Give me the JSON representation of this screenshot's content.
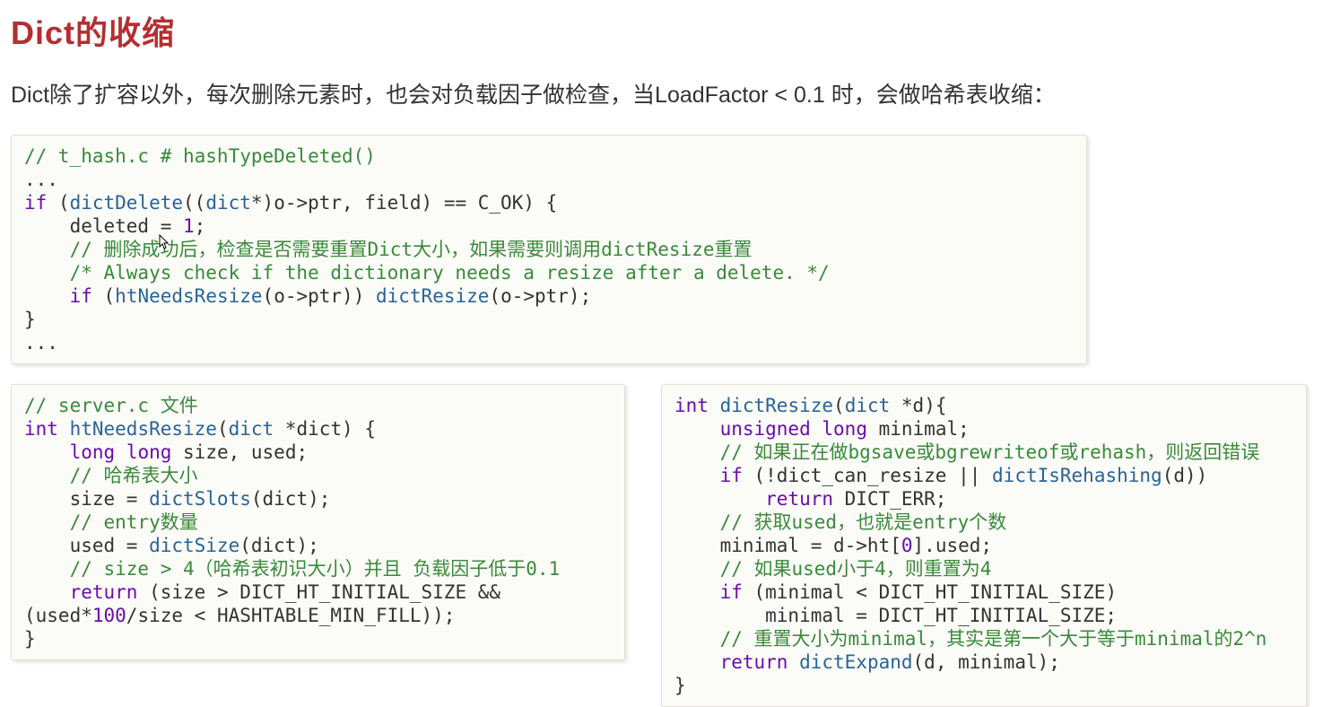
{
  "title": "Dict的收缩",
  "intro": "Dict除了扩容以外，每次删除元素时，也会对负载因子做检查，当LoadFactor < 0.1 时，会做哈希表收缩：",
  "code1": {
    "c1": "// t_hash.c # hashTypeDeleted()",
    "l2": "...",
    "kw_if": "if",
    "fn_dictDelete": "dictDelete",
    "lp1": "((",
    "type_dict1": "dict",
    "cast_tail": "*)o->ptr, field) == C_OK) {",
    "l4a": "    deleted ",
    "l4b": "= ",
    "one": "1",
    "semi": ";",
    "c5": "    // 删除成功后，检查是否需要重置Dict大小，如果需要则调用dictResize重置",
    "c6": "    /* Always check if the dictionary needs a resize after a delete. */",
    "kw_if2": "if",
    "fn_htNeedsResize": "htNeedsResize",
    "args7a": "(o->ptr)) ",
    "fn_dictResize1": "dictResize",
    "args7b": "(o->ptr);",
    "l8": "}",
    "l9": "..."
  },
  "code2": {
    "c1": "// server.c 文件",
    "kw_int": "int",
    "fn_name": "htNeedsResize",
    "lp": "(",
    "type_dict": "dict",
    "sig_tail": " *dict) {",
    "l3a": "    ",
    "kw_long1": "long",
    "kw_long2": "long",
    "l3b": " size, used;",
    "c4": "    // 哈希表大小",
    "l5a": "    size = ",
    "fn_dictSlots": "dictSlots",
    "l5b": "(dict);",
    "c6": "    // entry数量",
    "l7a": "    used = ",
    "fn_dictSize": "dictSize",
    "l7b": "(dict);",
    "c8": "    // size > 4（哈希表初识大小）并且 负载因子低于0.1",
    "l9a": "    ",
    "kw_return": "return",
    "l9b": " (size > DICT_HT_INITIAL_SIZE &&",
    "l10a": "(used*",
    "num100": "100",
    "l10b": "/size < HASHTABLE_MIN_FILL));",
    "l11": "}"
  },
  "code3": {
    "kw_int": "int",
    "fn_name": "dictResize",
    "lp": "(",
    "type_dict": "dict",
    "sig_tail": " *d){",
    "l2a": "    ",
    "kw_unsigned": "unsigned",
    "kw_long": "long",
    "l2b": " minimal;",
    "c3": "    // 如果正在做bgsave或bgrewriteof或rehash，则返回错误",
    "l4a": "    ",
    "kw_if": "if",
    "l4b": " (!dict_can_resize || ",
    "fn_isRehash": "dictIsRehashing",
    "l4c": "(d))",
    "l5a": "        ",
    "kw_return1": "return",
    "l5b": " DICT_ERR;",
    "c6": "    // 获取used，也就是entry个数",
    "l7a": "    minimal = d->ht[",
    "num0": "0",
    "l7b": "].used;",
    "c8": "    // 如果used小于4，则重置为4",
    "l9a": "    ",
    "kw_if2": "if",
    "l9b": " (minimal < DICT_HT_INITIAL_SIZE)",
    "l10": "        minimal = DICT_HT_INITIAL_SIZE;",
    "c11": "    // 重置大小为minimal，其实是第一个大于等于minimal的2^n",
    "l12a": "    ",
    "kw_return2": "return",
    "l12b": " ",
    "fn_dictExpand": "dictExpand",
    "l12c": "(d, minimal);",
    "l13": "}"
  }
}
